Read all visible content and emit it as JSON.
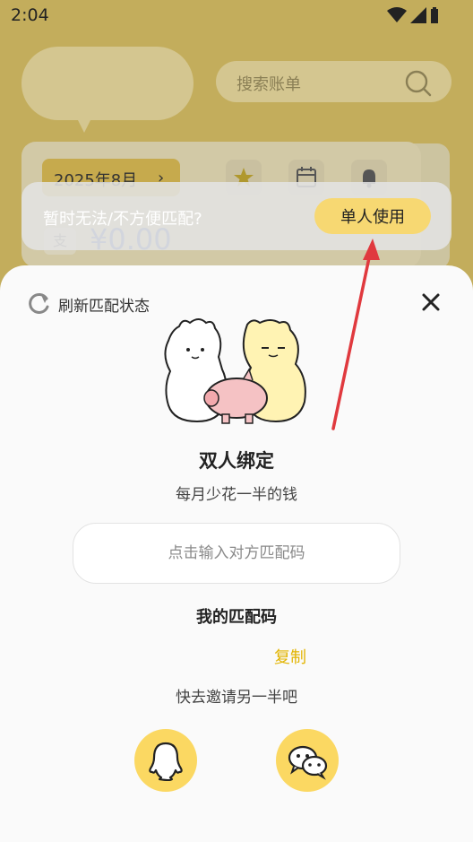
{
  "status": {
    "time": "2:04"
  },
  "search": {
    "placeholder": "搜索账单"
  },
  "calendar": {
    "month": "2025年8月",
    "expense_tag": "支",
    "amount": "¥0.00"
  },
  "toast": {
    "message": "暂时无法/不方便匹配?",
    "button_label": "单人使用"
  },
  "sheet": {
    "refresh_label": "刷新匹配状态",
    "title": "双人绑定",
    "subtitle": "每月少花一半的钱",
    "code_input_placeholder": "点击输入对方匹配码",
    "my_code_label": "我的匹配码",
    "copy_label": "复制",
    "invite_text": "快去邀请另一半吧",
    "share_buttons": [
      "qq-icon",
      "wechat-icon"
    ]
  },
  "colors": {
    "accent": "#fbd862",
    "copy": "#e2b400",
    "arrow": "#e0393e"
  }
}
